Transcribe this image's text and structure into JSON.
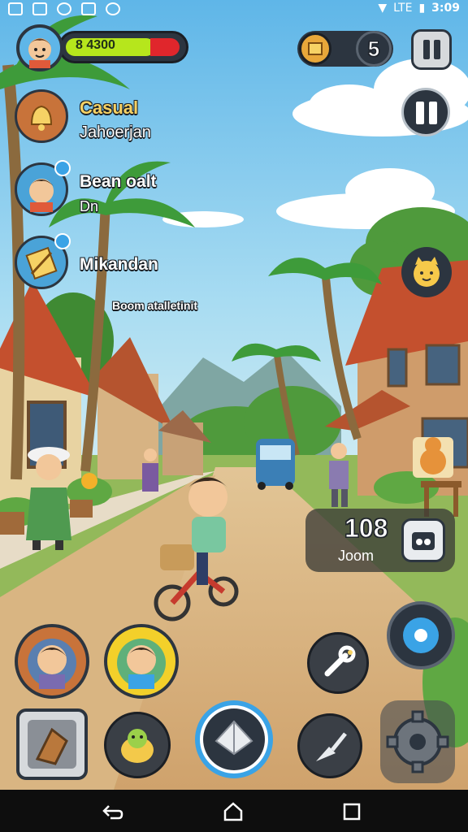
{
  "status_bar": {
    "time": "3:09",
    "network": "LTE"
  },
  "player": {
    "xp_value": "8 4300"
  },
  "hud": {
    "coin_icon": "coin-icon",
    "currency_value": "5"
  },
  "quests": [
    {
      "title": "Casual",
      "subtitle": "Jahoerjan"
    },
    {
      "title": "Bean oalt",
      "subtitle": "Dn"
    },
    {
      "title": "Mikandan",
      "subtitle": ""
    }
  ],
  "quest_hint": "Boom atalletinit",
  "counter_panel": {
    "value": "108",
    "label": "Joom"
  },
  "colors": {
    "xp_bar_green": "#b6e61c",
    "xp_bar_red": "#e0262c",
    "hud_dark": "#2c3540",
    "button_blue": "#3aa3e6"
  },
  "nav": {
    "back": "back-icon",
    "home": "home-icon",
    "recents": "recents-icon"
  }
}
